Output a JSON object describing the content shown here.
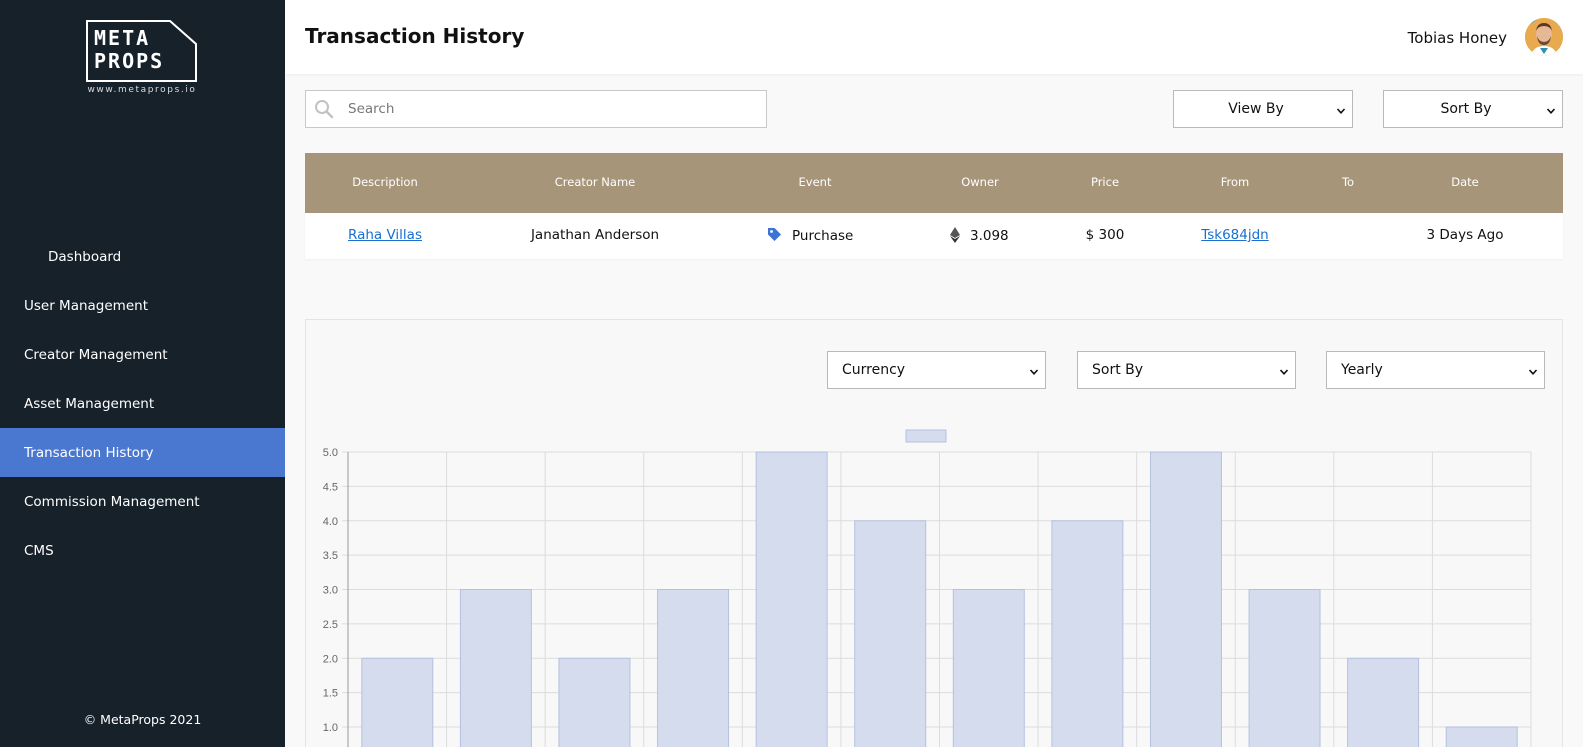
{
  "app": {
    "logo_text_line1": "META",
    "logo_text_line2": "PROPS",
    "logo_url": "www.metaprops.io",
    "copyright": "© MetaProps 2021"
  },
  "sidebar": {
    "items": [
      {
        "label": "Dashboard",
        "active": false
      },
      {
        "label": "User Management",
        "active": false
      },
      {
        "label": "Creator Management",
        "active": false
      },
      {
        "label": "Asset Management",
        "active": false
      },
      {
        "label": "Transaction History",
        "active": true
      },
      {
        "label": "Commission Management",
        "active": false
      },
      {
        "label": "CMS",
        "active": false
      }
    ]
  },
  "header": {
    "title": "Transaction History",
    "user_name": "Tobias Honey"
  },
  "toolbar": {
    "search_placeholder": "Search",
    "view_by": "View By",
    "sort_by": "Sort By"
  },
  "table": {
    "columns": [
      "Description",
      "Creator Name",
      "Event",
      "Owner",
      "Price",
      "From",
      "To",
      "Date"
    ],
    "rows": [
      {
        "description": "Raha Villas",
        "creator": "Janathan Anderson",
        "event": "Purchase",
        "owner": "3.098",
        "price": "$ 300",
        "from": "Tsk684jdn",
        "to": "",
        "date": "3 Days Ago"
      }
    ]
  },
  "chart_filters": {
    "currency": "Currency",
    "sort_by": "Sort By",
    "period": "Yearly"
  },
  "colors": {
    "sidebar_bg": "#17212a",
    "active_nav": "#4a78d0",
    "table_header": "#a69579",
    "bar_fill": "#d4dcee",
    "bar_stroke": "#b5c1de",
    "link": "#1a6fd1"
  },
  "chart_data": {
    "type": "bar",
    "categories": [
      "",
      "",
      "",
      "",
      "",
      "",
      "",
      "",
      "",
      "",
      "",
      ""
    ],
    "values": [
      2,
      3,
      2,
      3,
      5,
      4,
      3,
      4,
      5,
      3,
      2,
      1
    ],
    "ylim": [
      1.0,
      5.0
    ],
    "yticks": [
      "5.0",
      "4.5",
      "4.0",
      "3.5",
      "3.0",
      "2.5",
      "2.0",
      "1.5",
      "1.0"
    ],
    "grid": true,
    "legend": "top-center"
  }
}
